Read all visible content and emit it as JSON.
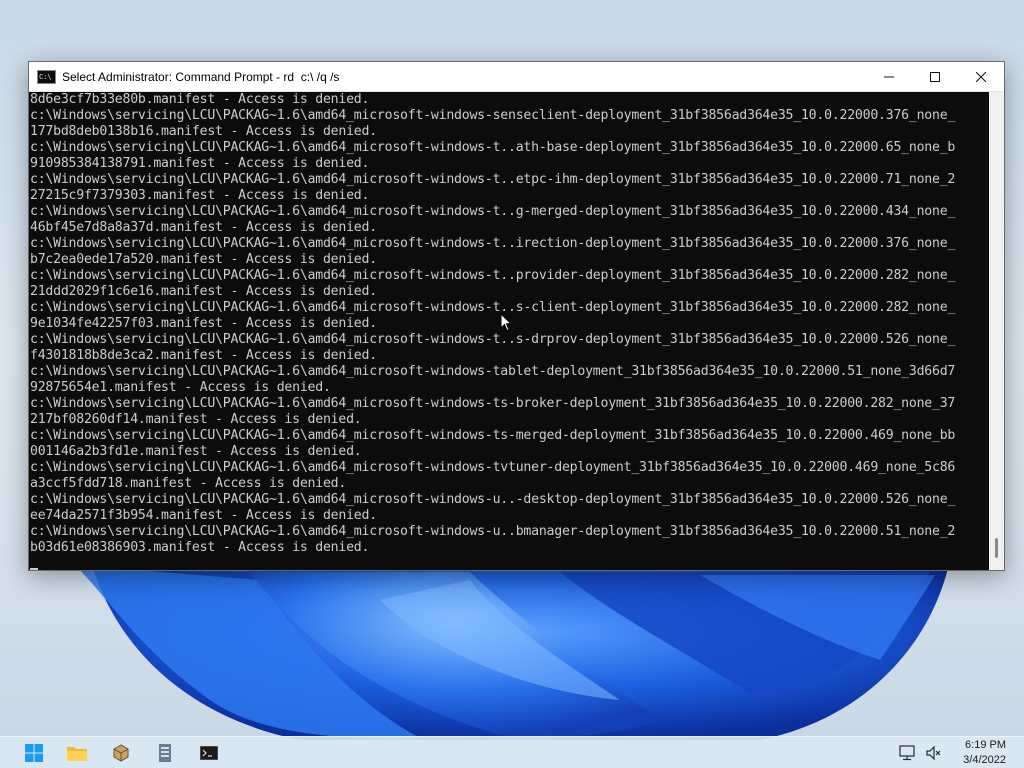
{
  "window": {
    "title": "Select Administrator: Command Prompt - rd  c:\\ /q /s",
    "icon_label": "C:\\",
    "controls": {
      "minimize": "minimize-icon",
      "maximize": "maximize-icon",
      "close": "close-icon"
    }
  },
  "console": {
    "background": "#0c0c0c",
    "foreground": "#cccccc",
    "lines": [
      "8d6e3cf7b33e80b.manifest - Access is denied.",
      "c:\\Windows\\servicing\\LCU\\PACKAG~1.6\\amd64_microsoft-windows-senseclient-deployment_31bf3856ad364e35_10.0.22000.376_none_",
      "177bd8deb0138b16.manifest - Access is denied.",
      "c:\\Windows\\servicing\\LCU\\PACKAG~1.6\\amd64_microsoft-windows-t..ath-base-deployment_31bf3856ad364e35_10.0.22000.65_none_b",
      "910985384138791.manifest - Access is denied.",
      "c:\\Windows\\servicing\\LCU\\PACKAG~1.6\\amd64_microsoft-windows-t..etpc-ihm-deployment_31bf3856ad364e35_10.0.22000.71_none_2",
      "27215c9f7379303.manifest - Access is denied.",
      "c:\\Windows\\servicing\\LCU\\PACKAG~1.6\\amd64_microsoft-windows-t..g-merged-deployment_31bf3856ad364e35_10.0.22000.434_none_",
      "46bf45e7d8a8a37d.manifest - Access is denied.",
      "c:\\Windows\\servicing\\LCU\\PACKAG~1.6\\amd64_microsoft-windows-t..irection-deployment_31bf3856ad364e35_10.0.22000.376_none_",
      "b7c2ea0ede17a520.manifest - Access is denied.",
      "c:\\Windows\\servicing\\LCU\\PACKAG~1.6\\amd64_microsoft-windows-t..provider-deployment_31bf3856ad364e35_10.0.22000.282_none_",
      "21ddd2029f1c6e16.manifest - Access is denied.",
      "c:\\Windows\\servicing\\LCU\\PACKAG~1.6\\amd64_microsoft-windows-t..s-client-deployment_31bf3856ad364e35_10.0.22000.282_none_",
      "9e1034fe42257f03.manifest - Access is denied.",
      "c:\\Windows\\servicing\\LCU\\PACKAG~1.6\\amd64_microsoft-windows-t..s-drprov-deployment_31bf3856ad364e35_10.0.22000.526_none_",
      "f4301818b8de3ca2.manifest - Access is denied.",
      "c:\\Windows\\servicing\\LCU\\PACKAG~1.6\\amd64_microsoft-windows-tablet-deployment_31bf3856ad364e35_10.0.22000.51_none_3d66d7",
      "92875654e1.manifest - Access is denied.",
      "c:\\Windows\\servicing\\LCU\\PACKAG~1.6\\amd64_microsoft-windows-ts-broker-deployment_31bf3856ad364e35_10.0.22000.282_none_37",
      "217bf08260df14.manifest - Access is denied.",
      "c:\\Windows\\servicing\\LCU\\PACKAG~1.6\\amd64_microsoft-windows-ts-merged-deployment_31bf3856ad364e35_10.0.22000.469_none_bb",
      "001146a2b3fd1e.manifest - Access is denied.",
      "c:\\Windows\\servicing\\LCU\\PACKAG~1.6\\amd64_microsoft-windows-tvtuner-deployment_31bf3856ad364e35_10.0.22000.469_none_5c86",
      "a3ccf5fdd718.manifest - Access is denied.",
      "c:\\Windows\\servicing\\LCU\\PACKAG~1.6\\amd64_microsoft-windows-u..-desktop-deployment_31bf3856ad364e35_10.0.22000.526_none_",
      "ee74da2571f3b954.manifest - Access is denied.",
      "c:\\Windows\\servicing\\LCU\\PACKAG~1.6\\amd64_microsoft-windows-u..bmanager-deployment_31bf3856ad364e35_10.0.22000.51_none_2",
      "b03d61e08386903.manifest - Access is denied."
    ]
  },
  "taskbar": {
    "icons": [
      "windows-start-icon",
      "file-explorer-icon",
      "package-icon",
      "server-manager-icon",
      "command-prompt-icon"
    ],
    "tray_icons": [
      "network-icon",
      "volume-icon"
    ],
    "clock": {
      "time": "6:19 PM",
      "date": "3/4/2022"
    }
  },
  "wallpaper": {
    "accent": "#1f5fd6",
    "background": "#d6e1ec"
  }
}
